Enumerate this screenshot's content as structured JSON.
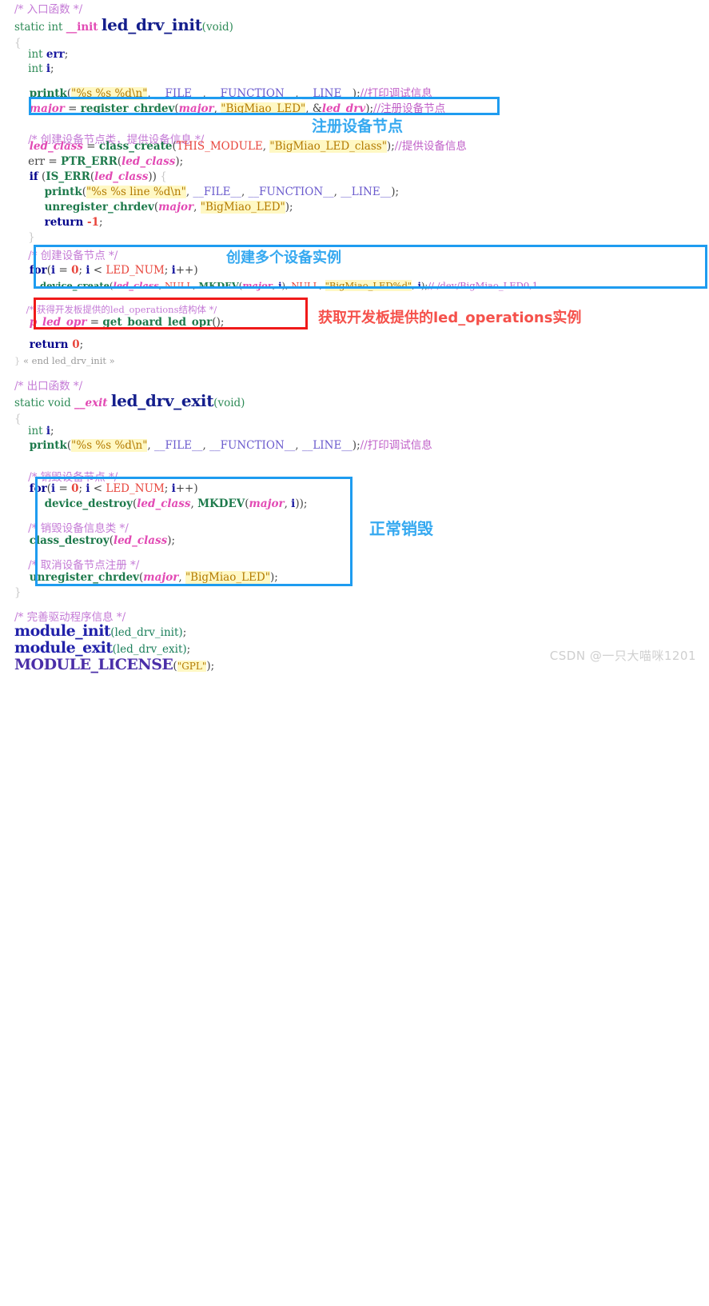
{
  "page": {
    "kind": "code-snippet-screenshot",
    "language": "c",
    "watermark": "CSDN @一只大喵咪1201"
  },
  "code": {
    "lines": [
      "/* 入口函数 */",
      "static int __init led_drv_init(void)",
      "{",
      "    int err;",
      "    int i;",
      "",
      "    printk(\"%s %s %d\\n\", __FILE__, __FUNCTION__, __LINE__);//打印调试信息",
      "    major = register_chrdev(major, \"BigMiao_LED\", &led_drv);//注册设备节点",
      "",
      "    /* 创建设备节点类，提供设备信息 */",
      "    led_class = class_create(THIS_MODULE, \"BigMiao_LED_class\");//提供设备信息",
      "    err = PTR_ERR(led_class);",
      "    if (IS_ERR(led_class)) {",
      "        printk(\"%s %s line %d\\n\", __FILE__, __FUNCTION__, __LINE__);",
      "        unregister_chrdev(major, \"BigMiao_LED\");",
      "        return -1;",
      "    }",
      "",
      "    /* 创建设备节点 */",
      "    for(i = 0; i < LED_NUM; i++)",
      "        device_create(led_class, NULL, MKDEV(major, i), NULL, \"BigMiao_LED%d\", i);// /dev/BigMiao_LED0,1...",
      "",
      "    /* 获得开发板提供的led_operations结构体 */",
      "    p_led_opr = get_board_led_opr();",
      "",
      "    return 0;",
      "} « end led_drv_init »",
      "",
      "/* 出口函数 */",
      "static void __exit led_drv_exit(void)",
      "{",
      "    int i;",
      "    printk(\"%s %s %d\\n\", __FILE__, __FUNCTION__, __LINE__);//打印调试信息",
      "",
      "    /* 销毁设备节点 */",
      "    for(i = 0; i < LED_NUM; i++)",
      "        device_destroy(led_class, MKDEV(major, i));",
      "",
      "    /* 销毁设备信息类 */",
      "    class_destroy(led_class);",
      "",
      "    /* 取消设备节点注册 */",
      "    unregister_chrdev(major, \"BigMiao_LED\");",
      "}",
      "",
      "/* 完善驱动程序信息 */",
      "module_init(led_drv_init);",
      "module_exit(led_drv_exit);",
      "MODULE_LICENSE(\"GPL\");"
    ],
    "tokens": {
      "comment_entry": "/* 入口函数 */",
      "comment_exit": "/* 出口函数 */",
      "comment_create_class": "/* 创建设备节点类，提供设备信息 */",
      "comment_create_node": "/* 创建设备节点 */",
      "comment_get_ops": "/* 获得开发板提供的led_operations结构体 */",
      "comment_destroy_node": "/* 销毁设备节点 */",
      "comment_destroy_class": "/* 销毁设备信息类 */",
      "comment_unregister": "/* 取消设备节点注册 */",
      "comment_module_info": "/* 完善驱动程序信息 */",
      "trailing_debug": "//打印调试信息",
      "trailing_register": "//注册设备节点",
      "trailing_provide": "//提供设备信息",
      "trailing_dev": "// /dev/BigMiao_LED0,1...",
      "end_marker_init": "« end led_drv_init »",
      "fn_init_name": "led_drv_init",
      "fn_exit_name": "led_drv_exit",
      "str_fmt1": "\"%s %s %d\\n\"",
      "str_fmt2": "\"%s %s line %d\\n\"",
      "str_dev": "\"BigMiao_LED\"",
      "str_class": "\"BigMiao_LED_class\"",
      "str_devfmt": "\"BigMiao_LED%d\"",
      "str_gpl": "\"GPL\""
    }
  },
  "annotations": [
    {
      "id": "anno-register-node",
      "text": "注册设备节点",
      "color": "#36a9f0",
      "style": "blue"
    },
    {
      "id": "anno-create-devices",
      "text": "创建多个设备实例",
      "color": "#36a9f0",
      "style": "blue"
    },
    {
      "id": "anno-get-ops",
      "text": "获取开发板提供的led_operations实例",
      "color": "#f5514b",
      "style": "red"
    },
    {
      "id": "anno-normal-destroy",
      "text": "正常销毁",
      "color": "#36a9f0",
      "style": "blue"
    }
  ],
  "boxes": [
    {
      "id": "box-register-chrdev",
      "color": "#1e9cf0",
      "style": "blue"
    },
    {
      "id": "box-device-create",
      "color": "#1e9cf0",
      "style": "blue"
    },
    {
      "id": "box-get-board-opr",
      "color": "#f01a1a",
      "style": "red"
    },
    {
      "id": "box-exit-cleanup",
      "color": "#1e9cf0",
      "style": "blue"
    }
  ],
  "colors": {
    "background": "#ffffff",
    "accent_blue": "#1e9cf0",
    "accent_red": "#f01a1a",
    "string_highlight": "#fff8c4",
    "watermark": "#cfcfcf"
  }
}
